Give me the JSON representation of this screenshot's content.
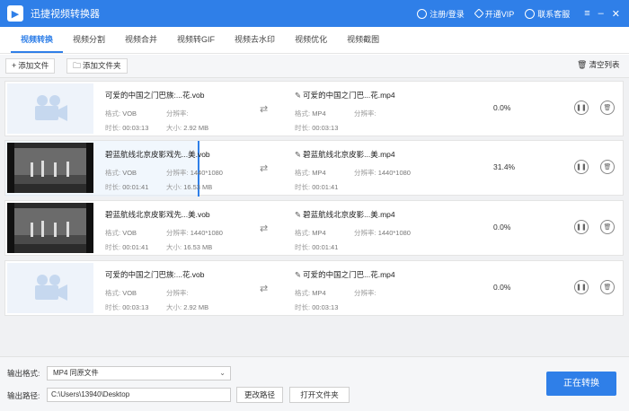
{
  "app": {
    "title": "迅捷视频转换器",
    "logo_glyph": "▶"
  },
  "top_actions": {
    "login": "注册/登录",
    "vip": "开通VIP",
    "service": "联系客服"
  },
  "tabs": [
    {
      "label": "视频转换",
      "active": true
    },
    {
      "label": "视频分割"
    },
    {
      "label": "视频合并"
    },
    {
      "label": "视频转GIF"
    },
    {
      "label": "视频去水印"
    },
    {
      "label": "视频优化"
    },
    {
      "label": "视频截图"
    }
  ],
  "toolbar": {
    "add_file": "添加文件",
    "add_folder": "添加文件夹",
    "clear_list": "清空列表"
  },
  "meta_labels": {
    "format": "格式:",
    "resolution": "分辨率:",
    "duration": "时长:",
    "size": "大小:"
  },
  "rows": [
    {
      "thumb": "placeholder",
      "src_name": "可爱的中国之门巴族:...花.vob",
      "src_format": "VOB",
      "src_resolution": "",
      "src_duration": "00:03:13",
      "src_size": "2.92 MB",
      "dst_name": "可爱的中国之门巴...花.mp4",
      "dst_format": "MP4",
      "dst_resolution": "",
      "dst_duration": "00:03:13",
      "progress_text": "0.0%",
      "progress": 0.0
    },
    {
      "thumb": "video",
      "src_name": "碧蓝航线北京皮影戏先...美.vob",
      "src_format": "VOB",
      "src_resolution": "1440*1080",
      "src_duration": "00:01:41",
      "src_size": "16.53 MB",
      "dst_name": "碧蓝航线北京皮影...美.mp4",
      "dst_format": "MP4",
      "dst_resolution": "1440*1080",
      "dst_duration": "00:01:41",
      "progress_text": "31.4%",
      "progress": 0.314
    },
    {
      "thumb": "video",
      "src_name": "碧蓝航线北京皮影戏先...美.vob",
      "src_format": "VOB",
      "src_resolution": "1440*1080",
      "src_duration": "00:01:41",
      "src_size": "16.53 MB",
      "dst_name": "碧蓝航线北京皮影...美.mp4",
      "dst_format": "MP4",
      "dst_resolution": "1440*1080",
      "dst_duration": "00:01:41",
      "progress_text": "0.0%",
      "progress": 0.0
    },
    {
      "thumb": "placeholder",
      "src_name": "可爱的中国之门巴族:...花.vob",
      "src_format": "VOB",
      "src_resolution": "",
      "src_duration": "00:03:13",
      "src_size": "2.92 MB",
      "dst_name": "可爱的中国之门巴...花.mp4",
      "dst_format": "MP4",
      "dst_resolution": "",
      "dst_duration": "00:03:13",
      "progress_text": "0.0%",
      "progress": 0.0
    }
  ],
  "bottom": {
    "format_label": "输出格式:",
    "format_value": "MP4  同原文件",
    "path_label": "输出路径:",
    "path_value": "C:\\Users\\13940\\Desktop",
    "change_path": "更改路径",
    "open_folder": "打开文件夹",
    "convert": "正在转换"
  },
  "colors": {
    "accent": "#2f7fe8"
  }
}
